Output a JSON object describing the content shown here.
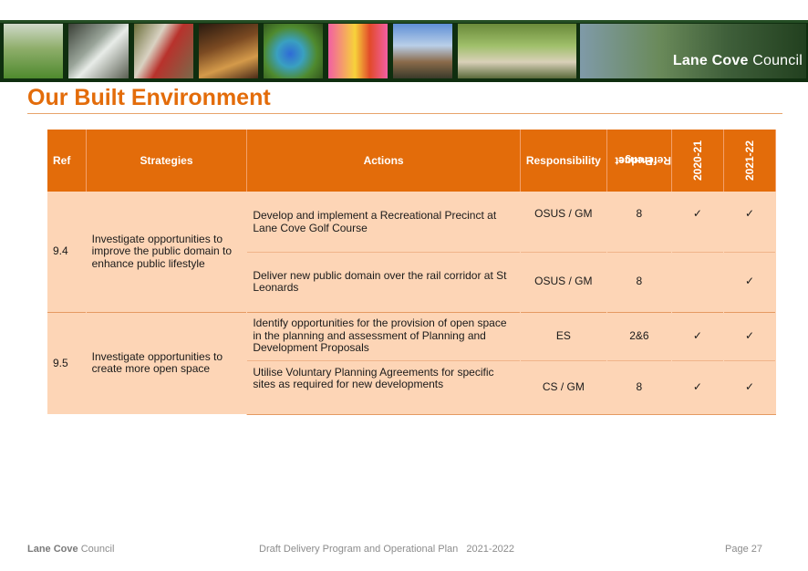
{
  "banner": {
    "logo_bold": "Lane Cove",
    "logo_light": "Council"
  },
  "page": {
    "title": "Our Built Environment"
  },
  "table": {
    "headers": {
      "ref": "Ref",
      "strategies": "Strategies",
      "actions": "Actions",
      "responsibility": "Responsibility",
      "budget_1": "Budget",
      "budget_2": "Reference",
      "y1": "2020-21",
      "y2": "2021-22"
    },
    "groups": [
      {
        "ref": "9.4",
        "strategy": "Investigate opportunities to improve the public domain to enhance public lifestyle",
        "rows": [
          {
            "action": "Develop and implement a Recreational Precinct at Lane Cove Golf Course",
            "responsibility": "OSUS / GM",
            "budget": "8",
            "y1": "✓",
            "y2": "✓"
          },
          {
            "action": "Deliver new public domain over the rail corridor at St Leonards",
            "responsibility": "OSUS / GM",
            "budget": "8",
            "y1": "",
            "y2": "✓"
          }
        ]
      },
      {
        "ref": "9.5",
        "strategy": "Investigate opportunities to create more open space",
        "rows": [
          {
            "action": "Identify opportunities for the provision of open space in the planning and assessment of Planning and Development Proposals",
            "responsibility": "ES",
            "budget": "2&6",
            "y1": "✓",
            "y2": "✓"
          },
          {
            "action": "Utilise Voluntary Planning Agreements for specific sites as required for new developments",
            "responsibility": "CS / GM",
            "budget": "8",
            "y1": "✓",
            "y2": "✓"
          }
        ]
      }
    ]
  },
  "footer": {
    "left_bold": "Lane Cove",
    "left_light": "Council",
    "middle": "Draft Delivery Program and Operational Plan   2021-2022",
    "page": "Page 27"
  }
}
